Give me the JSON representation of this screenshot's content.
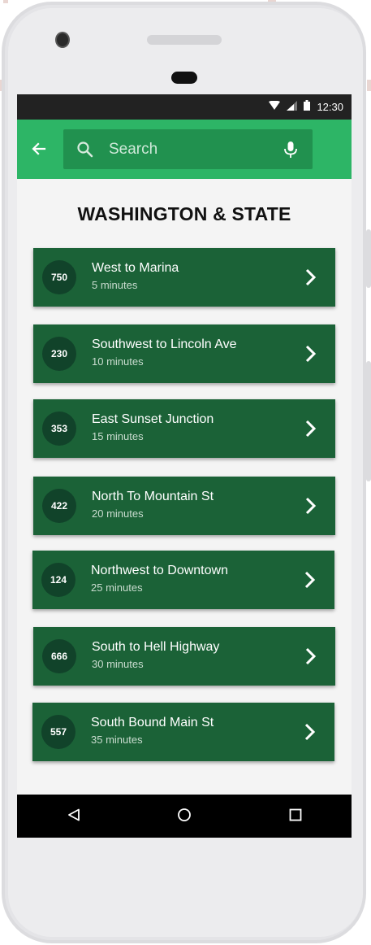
{
  "status_bar": {
    "time": "12:30"
  },
  "search": {
    "placeholder": "Search"
  },
  "page": {
    "title": "WASHINGTON & STATE"
  },
  "routes": [
    {
      "number": "750",
      "name": "West to Marina",
      "time": "5 minutes"
    },
    {
      "number": "230",
      "name": "Southwest to Lincoln Ave",
      "time": "10 minutes"
    },
    {
      "number": "353",
      "name": "East Sunset Junction",
      "time": "15 minutes"
    },
    {
      "number": "422",
      "name": "North To Mountain St",
      "time": "20 minutes"
    },
    {
      "number": "124",
      "name": "Northwest to Downtown",
      "time": "25 minutes"
    },
    {
      "number": "666",
      "name": "South to Hell Highway",
      "time": "30 minutes"
    },
    {
      "number": "557",
      "name": "South Bound Main St",
      "time": "35 minutes"
    }
  ],
  "icons": {
    "back": "arrow-back-icon",
    "search": "search-icon",
    "mic": "mic-icon",
    "chevron": "chevron-right-icon",
    "wifi": "wifi-icon",
    "signal": "signal-icon",
    "battery": "battery-icon",
    "nav_back": "triangle-back-icon",
    "nav_home": "circle-home-icon",
    "nav_recents": "square-recents-icon"
  },
  "colors": {
    "app_bar": "#2db566",
    "search_box": "#21914f",
    "card": "#1b6237",
    "badge": "#11432a",
    "background": "#f4f4f4"
  }
}
